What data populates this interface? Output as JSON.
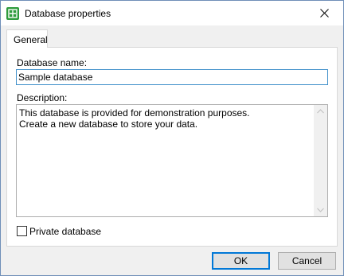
{
  "window": {
    "title": "Database properties"
  },
  "tabs": [
    {
      "label": "General",
      "selected": true
    }
  ],
  "form": {
    "name_label": "Database name:",
    "name_value": "Sample database",
    "description_label": "Description:",
    "description_value": "This database is provided for demonstration purposes.\nCreate a new database to store your data.",
    "private_label": "Private database",
    "private_checked": false
  },
  "buttons": {
    "ok_label": "OK",
    "cancel_label": "Cancel"
  },
  "icons": {
    "app": "database-app-icon",
    "close": "close-icon",
    "scroll_up": "scroll-up-arrow-icon",
    "scroll_down": "scroll-down-arrow-icon"
  },
  "colors": {
    "accent": "#0078d7",
    "app_icon": "#2e9b3c",
    "focus_border": "#3d8ec9"
  }
}
